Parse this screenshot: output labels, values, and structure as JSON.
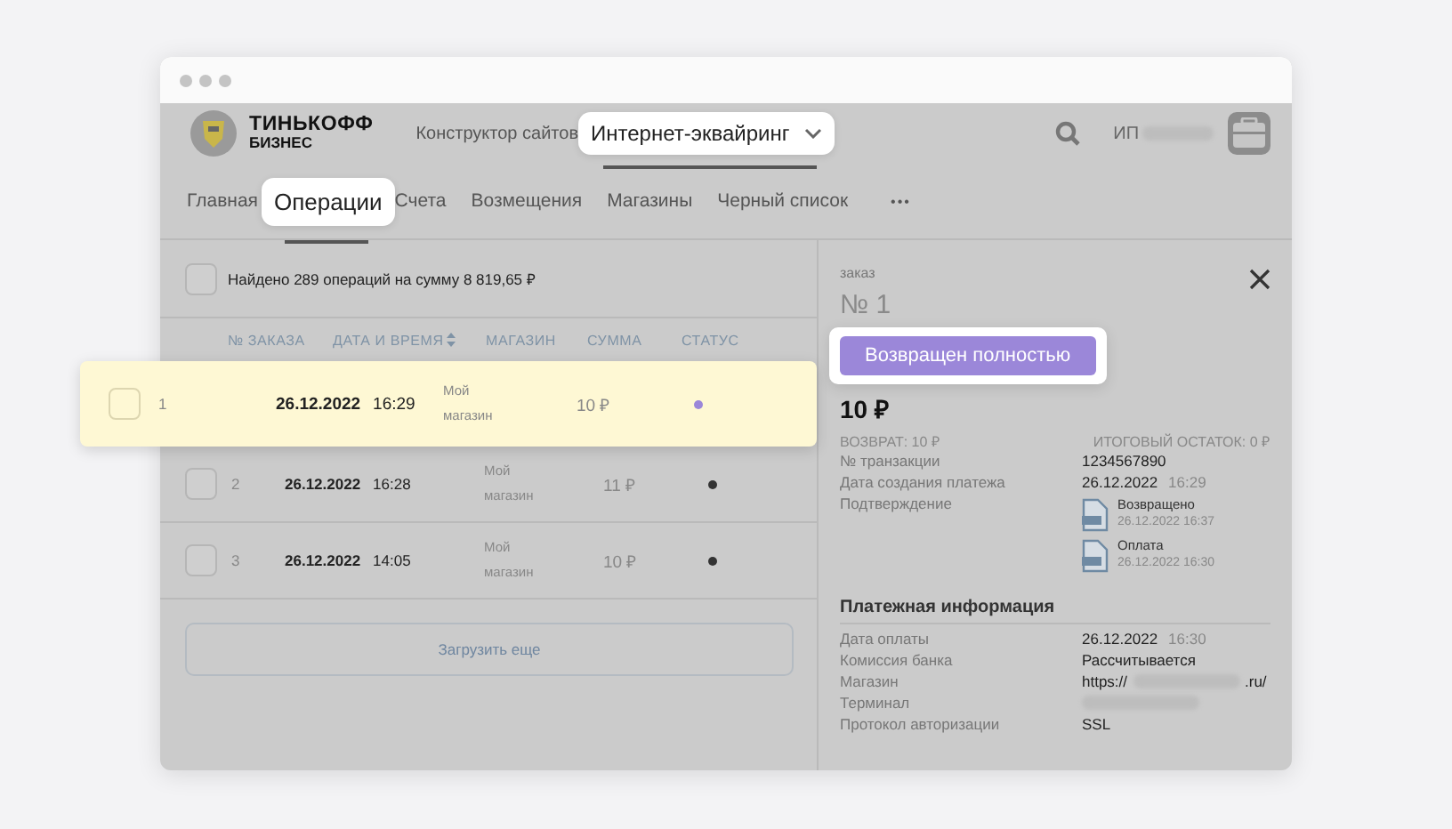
{
  "header": {
    "logo": {
      "line1": "ТИНЬКОФФ",
      "line2": "БИЗНЕС"
    },
    "products": [
      {
        "label": "Конструктор сайтов",
        "selected": false
      },
      {
        "label": "Интернет-эквайринг",
        "selected": true
      }
    ],
    "user": {
      "prefix": "ИП"
    }
  },
  "tabs": [
    {
      "label": "Главная",
      "selected": false
    },
    {
      "label": "Операции",
      "selected": true
    },
    {
      "label": "Счета",
      "selected": false
    },
    {
      "label": "Возмещения",
      "selected": false
    },
    {
      "label": "Магазины",
      "selected": false
    },
    {
      "label": "Черный список",
      "selected": false
    }
  ],
  "more": "•••",
  "summary": {
    "text": "Найдено 289 операций на сумму 8 819,65 ₽",
    "checked": false
  },
  "columns": [
    "№ ЗАКАЗА",
    "ДАТА И ВРЕМЯ",
    "МАГАЗИН",
    "СУММА",
    "СТАТУС"
  ],
  "rows": [
    {
      "number": "1",
      "date": "26.12.2022",
      "time": "16:29",
      "store": "Мой магазин",
      "amount": "10 ₽",
      "color": "#9b87d9",
      "selected": true,
      "checked": false
    },
    {
      "number": "2",
      "date": "26.12.2022",
      "time": "16:28",
      "store": "Мой магазин",
      "amount": "11 ₽",
      "color": "#333333",
      "selected": false,
      "checked": false
    },
    {
      "number": "3",
      "date": "26.12.2022",
      "time": "14:05",
      "store": "Мой магазин",
      "amount": "10 ₽",
      "color": "#333333",
      "selected": false,
      "checked": false
    }
  ],
  "load_more": "Загрузить еще",
  "detail": {
    "label": "заказ",
    "number": "№ 1",
    "status": "Возвращен полностью",
    "amount": "10 ₽",
    "refund": "ВОЗВРАТ: 10 ₽",
    "balance": "ИТОГОВЫЙ ОСТАТОК: 0 ₽",
    "fields": [
      {
        "label": "№ транзакции",
        "value": "1234567890"
      },
      {
        "label": "Дата создания платежа",
        "value": "26.12.2022",
        "time": "16:29"
      }
    ],
    "confirmation": {
      "label": "Подтверждение",
      "documents": [
        {
          "title": "Возвращено",
          "date": "26.12.2022 16:37"
        },
        {
          "title": "Оплата",
          "date": "26.12.2022 16:30"
        }
      ]
    },
    "payment_title": "Платежная информация",
    "payment": [
      {
        "kind": "text",
        "label": "Дата оплаты",
        "value": "26.12.2022",
        "time": "16:30"
      },
      {
        "kind": "text",
        "label": "Комиссия банка",
        "value": "Рассчитывается"
      },
      {
        "kind": "url",
        "label": "Магазин",
        "value_start": "https://",
        "value_end": ".ru/"
      },
      {
        "kind": "blurred",
        "label": "Терминал"
      },
      {
        "kind": "text",
        "label": "Протокол авторизации",
        "value": "SSL"
      }
    ]
  }
}
